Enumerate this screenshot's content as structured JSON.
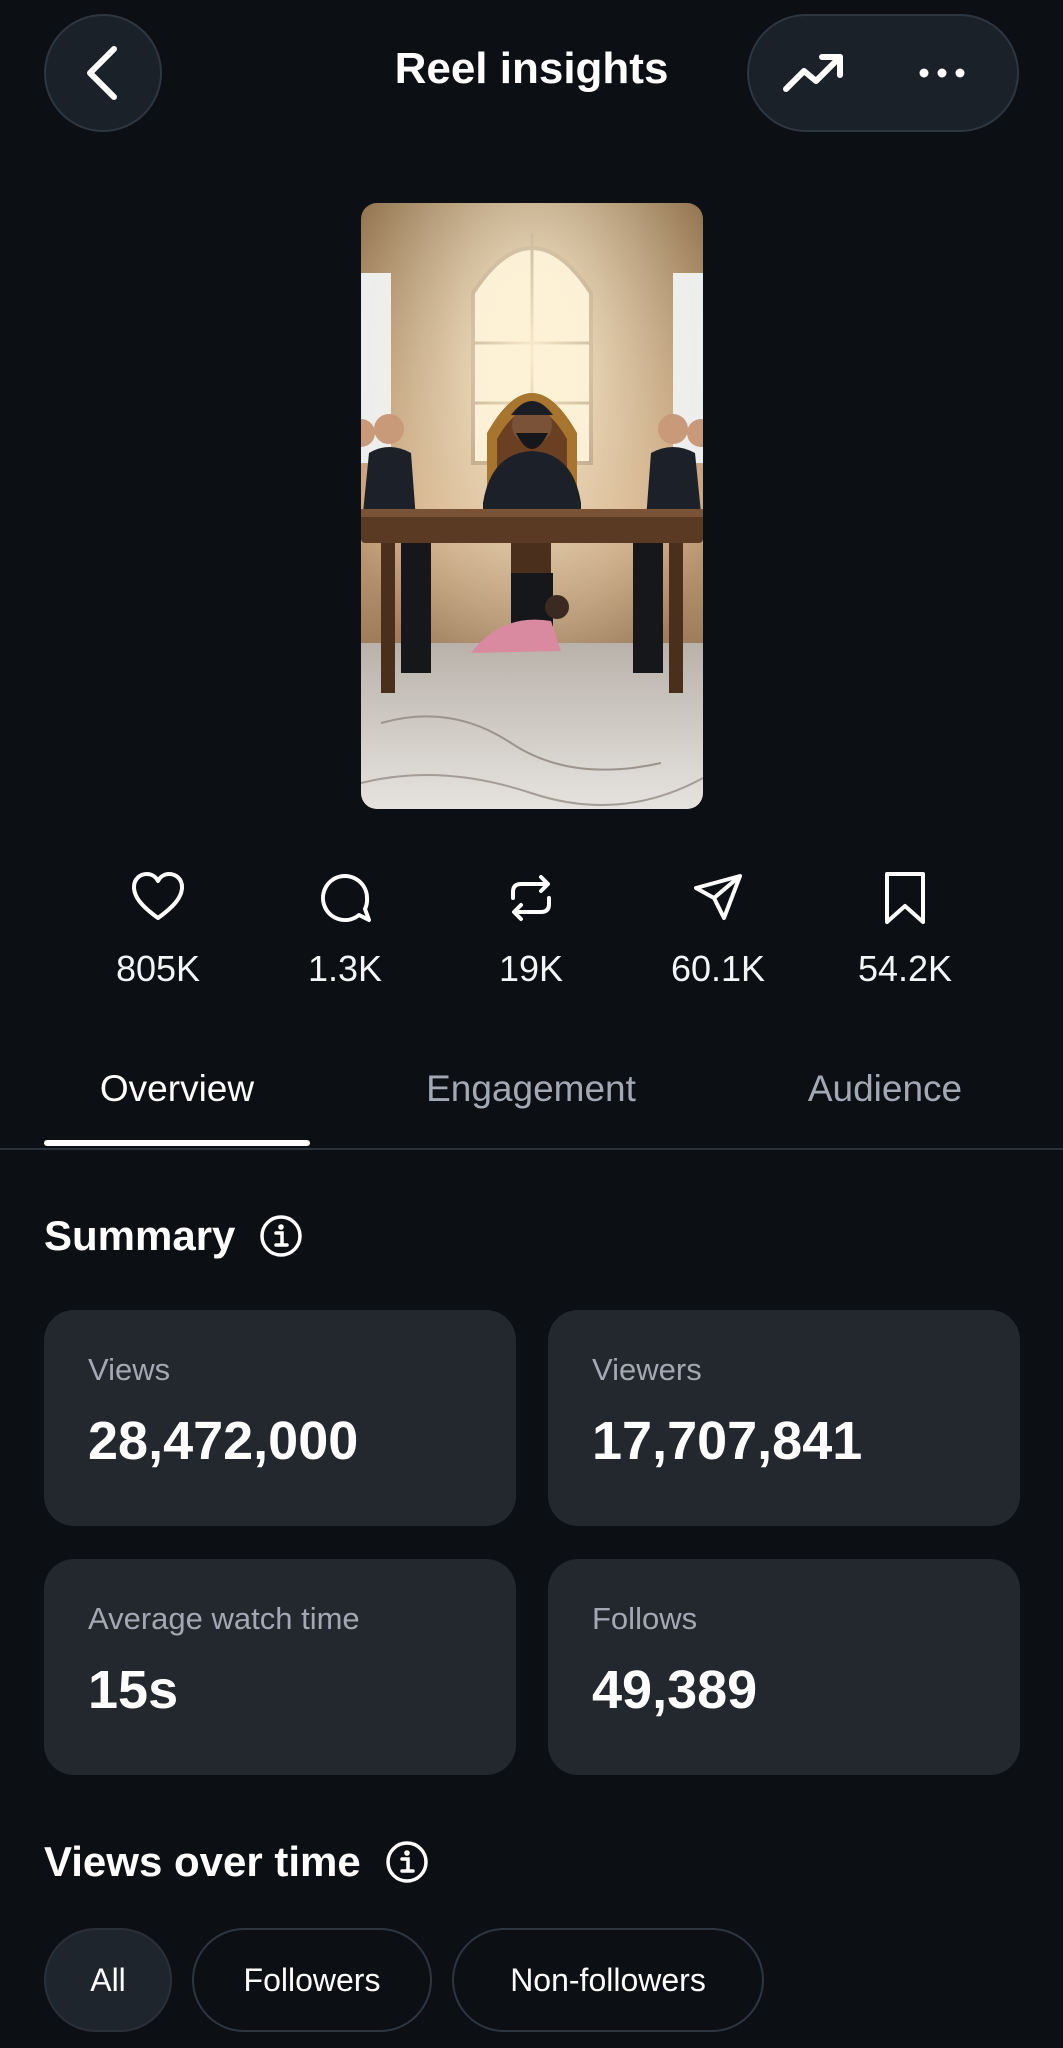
{
  "header": {
    "title": "Reel insights",
    "back_icon": "chevron-left-icon",
    "trend_icon": "trending-up-icon",
    "more_icon": "more-horizontal-icon"
  },
  "thumbnail": {
    "icon": "reel-thumbnail"
  },
  "stats": [
    {
      "icon": "heart-icon",
      "value": "805K"
    },
    {
      "icon": "comment-icon",
      "value": "1.3K"
    },
    {
      "icon": "repost-icon",
      "value": "19K"
    },
    {
      "icon": "share-icon",
      "value": "60.1K"
    },
    {
      "icon": "bookmark-icon",
      "value": "54.2K"
    }
  ],
  "tabs": [
    {
      "label": "Overview",
      "active": true
    },
    {
      "label": "Engagement",
      "active": false
    },
    {
      "label": "Audience",
      "active": false
    }
  ],
  "summary": {
    "title": "Summary",
    "cards": [
      {
        "label": "Views",
        "value": "28,472,000"
      },
      {
        "label": "Viewers",
        "value": "17,707,841"
      },
      {
        "label": "Average watch time",
        "value": "15s"
      },
      {
        "label": "Follows",
        "value": "49,389"
      }
    ]
  },
  "views_over_time": {
    "title": "Views over time",
    "filters": [
      {
        "label": "All",
        "selected": true
      },
      {
        "label": "Followers",
        "selected": false
      },
      {
        "label": "Non-followers",
        "selected": false
      }
    ]
  },
  "colors": {
    "background": "#0c0f14",
    "card": "#23272e",
    "muted_text": "#a3a9b3",
    "text": "#ffffff"
  }
}
